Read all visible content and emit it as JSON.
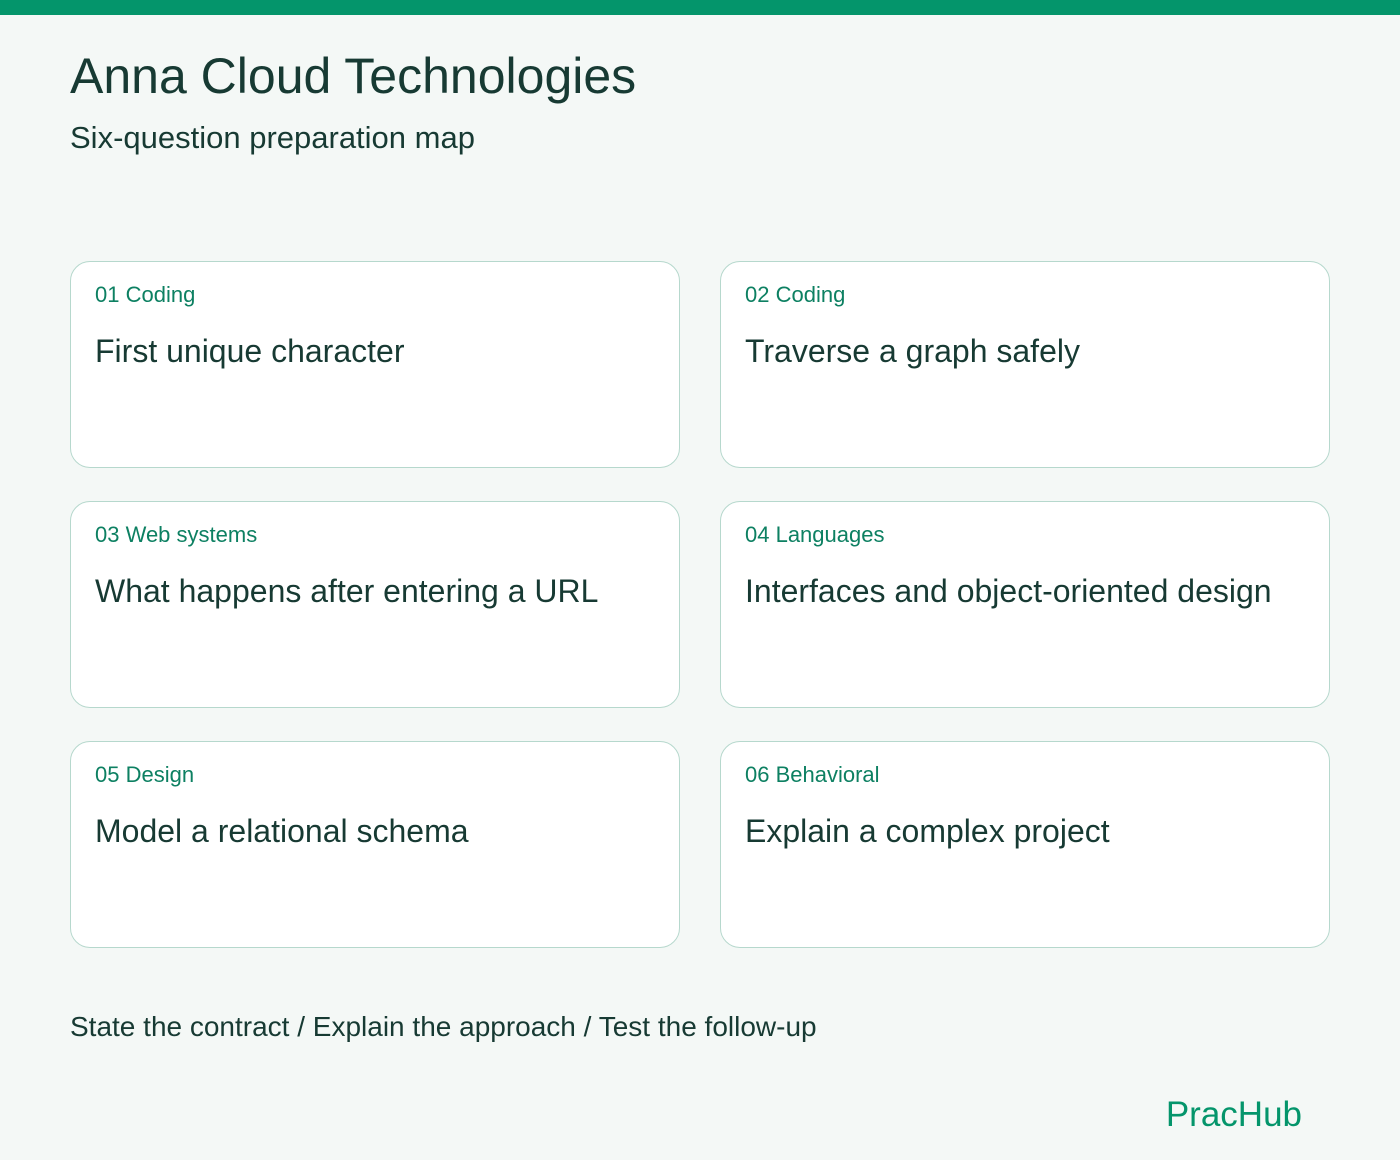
{
  "header": {
    "title": "Anna Cloud Technologies",
    "subtitle": "Six-question preparation map"
  },
  "questions": [
    {
      "tag": "01 Coding",
      "title": "First unique character"
    },
    {
      "tag": "02 Coding",
      "title": "Traverse a graph safely"
    },
    {
      "tag": "03 Web systems",
      "title": "What happens after entering a URL"
    },
    {
      "tag": "04 Languages",
      "title": "Interfaces and object-oriented design"
    },
    {
      "tag": "05 Design",
      "title": "Model a relational schema"
    },
    {
      "tag": "06 Behavioral",
      "title": "Explain a complex project"
    }
  ],
  "footer": {
    "steps": "State the contract / Explain the approach / Test the follow-up",
    "brand": "PracHub"
  },
  "colors": {
    "accent": "#04956b",
    "tag_text": "#0d8062",
    "text": "#173a33",
    "card_border": "#b6d8cd",
    "background": "#f4f8f6"
  }
}
